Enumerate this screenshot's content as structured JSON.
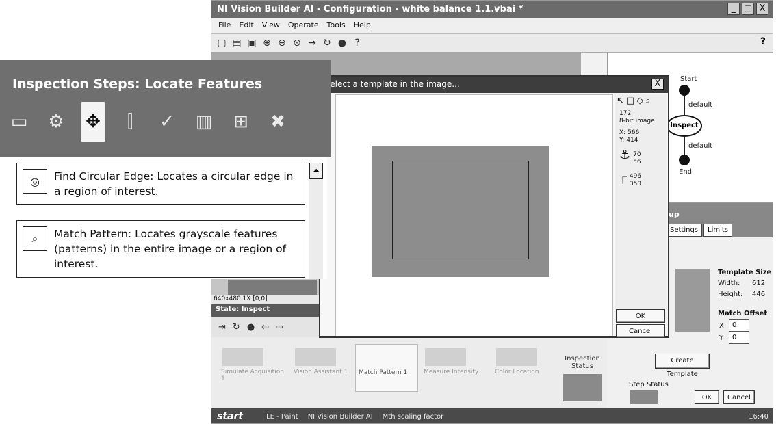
{
  "window": {
    "title": "NI Vision Builder AI - Configuration - white balance 1.1.vbai *",
    "buttons": [
      "_",
      "□",
      "X"
    ],
    "menu": [
      "File",
      "Edit",
      "View",
      "Operate",
      "Tools",
      "Help"
    ],
    "toolbar_icons": [
      "new-icon",
      "open-icon",
      "save-icon",
      "zoom-in-icon",
      "zoom-out-icon",
      "zoom-fit-icon",
      "step-icon",
      "run-icon",
      "stop-icon",
      "help-icon"
    ],
    "help_label": "?"
  },
  "callout": {
    "title": "Inspection Steps: Locate Features",
    "tabs": [
      "acquire-icon",
      "enhance-icon",
      "locate-icon",
      "measure-icon",
      "check-icon",
      "identify-icon",
      "communicate-icon",
      "tools-icon"
    ],
    "items": [
      {
        "icon": "circular-edge-icon",
        "text": "Find Circular Edge:  Locates a circular edge in a region of interest."
      },
      {
        "icon": "match-pattern-icon",
        "text": "Match Pattern:  Locates grayscale features (patterns) in the entire image or a region of interest."
      }
    ],
    "scroll_up": "⏶"
  },
  "dialog": {
    "title": "select a template in the image...",
    "close": "X",
    "info": {
      "value": "172",
      "type": "8-bit image",
      "x_label": "X:",
      "x": "566",
      "y_label": "Y:",
      "y": "414",
      "anchor_x": "70",
      "anchor_y": "56",
      "size_w": "496",
      "size_h": "350"
    },
    "ok": "OK",
    "cancel": "Cancel"
  },
  "flow": {
    "start": "Start",
    "default1": "default",
    "inspect": "Inspect",
    "default2": "default",
    "end": "End"
  },
  "setup": {
    "banner": "up",
    "tabs": [
      "Settings",
      "Limits"
    ],
    "template_size": "Template Size",
    "width_label": "Width:",
    "width": "612",
    "height_label": "Height:",
    "height": "446",
    "match_offset": "Match Offset",
    "x_label": "X",
    "x_value": "0",
    "y_label": "Y",
    "y_value": "0",
    "create_template": "Create Template",
    "step_status": "Step Status",
    "ok": "OK",
    "cancel": "Cancel"
  },
  "image_info": "640x480 1X  [0,0]",
  "state": "State:   Inspect",
  "steps": [
    {
      "label": "Simulate Acquisition 1"
    },
    {
      "label": "Vision Assistant 1"
    },
    {
      "label": "Match Pattern 1"
    },
    {
      "label": "Measure Intensity"
    },
    {
      "label": "Color Location"
    }
  ],
  "inspection_status": "Inspection Status",
  "taskbar": {
    "start": "start",
    "items": [
      "LE - Paint",
      "NI Vision Builder AI",
      "Mth scaling factor"
    ],
    "clock": "16:40"
  }
}
